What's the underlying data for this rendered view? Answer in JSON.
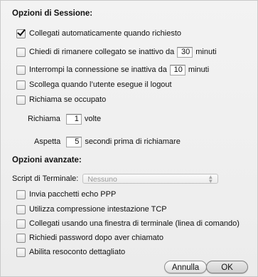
{
  "session": {
    "title": "Opzioni di Sessione:",
    "auto_connect": {
      "label": "Collegati automaticamente quando richiesto",
      "checked": true
    },
    "ask_stay": {
      "label_before": "Chiedi di rimanere collegato se inattivo da",
      "value": "30",
      "label_after": "minuti",
      "checked": false
    },
    "disconnect_idle": {
      "label_before": "Interrompi la connessione se inattiva da",
      "value": "10",
      "label_after": "minuti",
      "checked": false
    },
    "disconnect_logout": {
      "label": "Scollega quando l’utente esegue il logout",
      "checked": false
    },
    "redial_busy": {
      "label": "Richiama se occupato",
      "checked": false
    },
    "redial_count": {
      "label_before": "Richiama",
      "value": "1",
      "label_after": "volte"
    },
    "redial_wait": {
      "label_before": "Aspetta",
      "value": "5",
      "label_after": "secondi prima di richiamare"
    }
  },
  "advanced": {
    "title": "Opzioni avanzate:",
    "terminal_script": {
      "label": "Script di Terminale:",
      "value": "Nessuno"
    },
    "echo_ppp": {
      "label": "Invia pacchetti echo PPP",
      "checked": false
    },
    "tcp_compress": {
      "label": "Utilizza compressione intestazione TCP",
      "checked": false
    },
    "terminal_window": {
      "label": "Collegati usando una finestra di terminale (linea di comando)",
      "checked": false
    },
    "ask_password": {
      "label": "Richiedi password dopo aver chiamato",
      "checked": false
    },
    "verbose_log": {
      "label": "Abilita resoconto dettagliato",
      "checked": false
    }
  },
  "buttons": {
    "cancel": "Annulla",
    "ok": "OK"
  },
  "icons": {
    "popup_arrows": "updown-arrows-icon",
    "checkmark": "checkmark-icon"
  }
}
